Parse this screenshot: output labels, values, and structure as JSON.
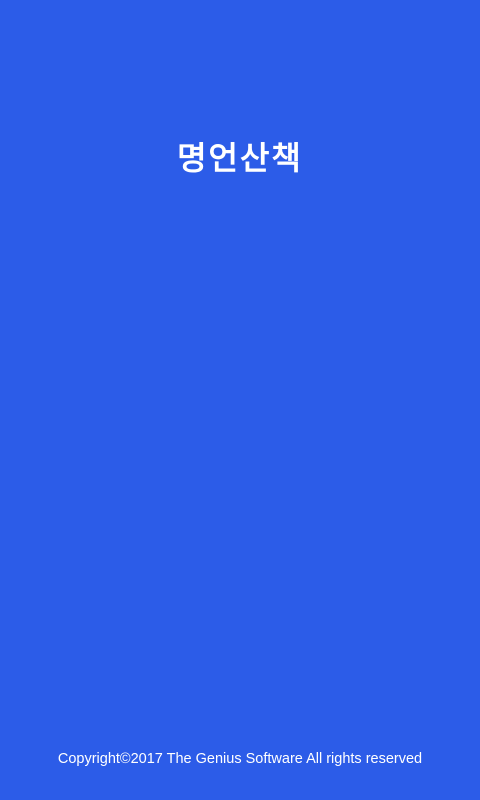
{
  "splash": {
    "title": "명언산책",
    "copyright": "Copyright©2017 The Genius Software All rights reserved"
  },
  "colors": {
    "background": "#2C5CE8",
    "text": "#FFFFFF"
  }
}
